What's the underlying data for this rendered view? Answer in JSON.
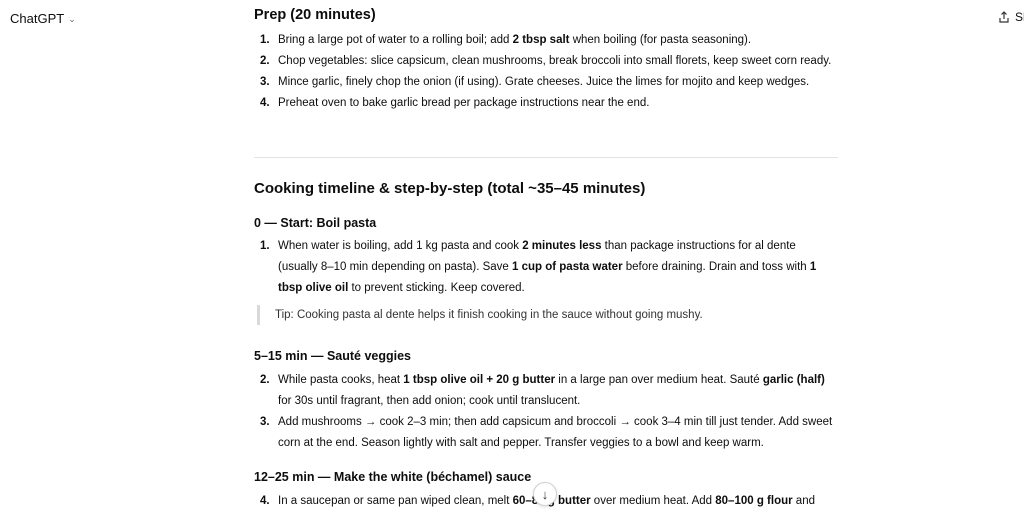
{
  "header": {
    "app_title": "ChatGPT",
    "share_label": "Sh"
  },
  "prep": {
    "heading": "Prep (20 minutes)",
    "items": [
      {
        "num": "1.",
        "parts": [
          "Bring a large pot of water to a rolling boil; add ",
          "2 tbsp salt",
          " when boiling (for pasta seasoning)."
        ]
      },
      {
        "num": "2.",
        "text": "Chop vegetables: slice capsicum, clean mushrooms, break broccoli into small florets, keep sweet corn ready."
      },
      {
        "num": "3.",
        "text": "Mince garlic, finely chop the onion (if using). Grate cheeses. Juice the limes for mojito and keep wedges."
      },
      {
        "num": "4.",
        "text": "Preheat oven to bake garlic bread per package instructions near the end."
      }
    ]
  },
  "timeline": {
    "heading": "Cooking timeline & step-by-step (total ~35–45 minutes)",
    "s1": {
      "heading": "0 — Start: Boil pasta",
      "item": {
        "num": "1.",
        "parts": [
          "When water is boiling, add 1 kg pasta and cook ",
          "2 minutes less",
          " than package instructions for al dente (usually 8–10 min depending on pasta). Save ",
          "1 cup of pasta water",
          " before draining. Drain and toss with ",
          "1 tbsp olive oil",
          " to prevent sticking. Keep covered."
        ]
      },
      "tip": "Tip: Cooking pasta al dente helps it finish cooking in the sauce without going mushy."
    },
    "s2": {
      "heading": "5–15 min — Sauté veggies",
      "item2": {
        "num": "2.",
        "parts": [
          "While pasta cooks, heat ",
          "1 tbsp olive oil + 20 g butter",
          " in a large pan over medium heat. Sauté ",
          "garlic (half)",
          " for 30s until fragrant, then add onion; cook until translucent."
        ]
      },
      "item3": {
        "num": "3.",
        "text": "Add mushrooms → cook 2–3 min; then add capsicum and broccoli → cook 3–4 min till just tender. Add sweet corn at the end. Season lightly with salt and pepper. Transfer veggies to a bowl and keep warm."
      }
    },
    "s3": {
      "heading": "12–25 min — Make the white (béchamel) sauce",
      "item4": {
        "num": "4.",
        "parts": [
          "In a saucepan or same pan wiped clean, melt ",
          "60–80 g butter",
          " over medium heat. Add ",
          "80–100 g flour",
          " and"
        ]
      }
    }
  },
  "icons": {
    "chevron": "chevron-down-icon",
    "share": "share-icon",
    "scroll": "arrow-down-icon"
  }
}
